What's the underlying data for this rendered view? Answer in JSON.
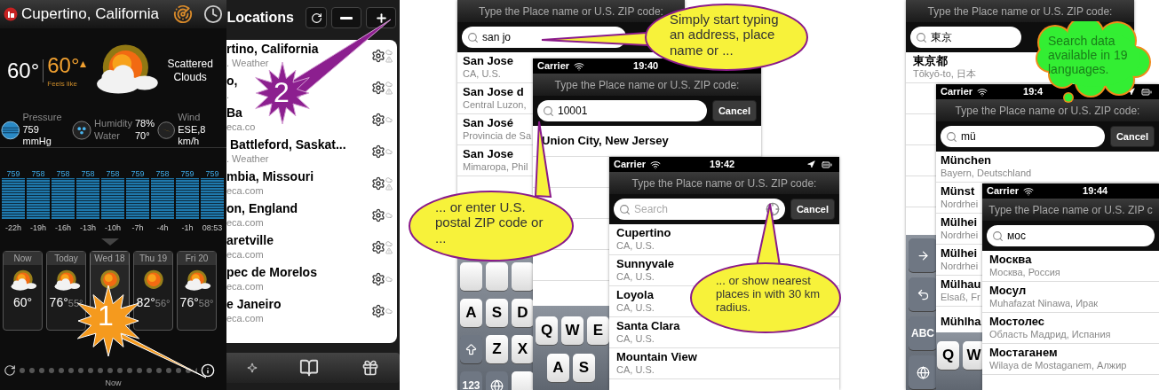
{
  "weather": {
    "location": "Cupertino, California",
    "temperature": "60°",
    "feels_like_temp": "60°",
    "feels_like_label": "Feels like",
    "condition": "Scattered Clouds",
    "stats": [
      {
        "kind": "pressure",
        "label": "Pressure",
        "value": "759 mmHg"
      },
      {
        "kind": "humidity",
        "label": "Humidity",
        "value": "78%",
        "label_2": "Water",
        "value_2": "70°"
      },
      {
        "kind": "wind",
        "label": "Wind",
        "value": "ESE,8 km/h"
      }
    ],
    "pressure_chart": {
      "chart_data": {
        "type": "bar",
        "categories": [
          "-22h",
          "-19h",
          "-16h",
          "-13h",
          "-10h",
          "-7h",
          "-4h",
          "-1h",
          "08:53"
        ],
        "values": [
          759,
          758,
          758,
          758,
          758,
          759,
          758,
          759,
          759
        ],
        "data_labels": true
      }
    },
    "forecast": [
      {
        "day": "Now",
        "high": "60°",
        "kind": "partly-cloudy",
        "selected": false
      },
      {
        "day": "Today",
        "high": "76°",
        "low": "55°",
        "kind": "partly-cloudy",
        "selected": false
      },
      {
        "day": "Wed 18",
        "kind": "sunny",
        "selected": true
      },
      {
        "day": "Thu 19",
        "high": "82°",
        "low": "56°",
        "kind": "sunny",
        "selected": false
      },
      {
        "day": "Fri 20",
        "high": "76°",
        "low": "58°",
        "kind": "partly-cloudy",
        "selected": false
      }
    ],
    "footer_label": "Now"
  },
  "locations": {
    "title": "Locations",
    "items": [
      {
        "name": "rtino, California",
        "source": ". Weather",
        "alert": true
      },
      {
        "name": "o,",
        "source": ".",
        "alert": true
      },
      {
        "name": "Ba",
        "source": "eca.co",
        "alert": false
      },
      {
        "name": " Battleford, Saskat...",
        "source": ". Weather",
        "alert": false
      },
      {
        "name": "mbia, Missouri",
        "source": "eca.com",
        "alert": true
      },
      {
        "name": "on, England",
        "source": "eca.com",
        "alert": false
      },
      {
        "name": "aretville",
        "source": "eca.com",
        "alert": true
      },
      {
        "name": "pec de Morelos",
        "source": "eca.com",
        "alert": false
      },
      {
        "name": "e Janeiro",
        "source": "eca.com",
        "alert": false
      }
    ]
  },
  "search_screens": [
    {
      "prompt": "Type the Place name or U.S. ZIP code:",
      "query": "san jo",
      "results": [
        {
          "name": "San Jose",
          "region": "CA, U.S."
        },
        {
          "name": "San Jose d",
          "region": "Central Luzon,"
        },
        {
          "name": "San José",
          "region": "Provincia de Sa"
        },
        {
          "name": "San Jose",
          "region": "Mimaropa, Phil"
        }
      ],
      "keyboard": [
        [
          {
            "kind": "blank"
          },
          {
            "kind": "blank"
          },
          {
            "kind": "blank"
          }
        ],
        [
          {
            "kind": "letter",
            "label": "A"
          },
          {
            "kind": "letter",
            "label": "S"
          },
          {
            "kind": "letter",
            "label": "D"
          }
        ],
        [
          {
            "kind": "shift"
          },
          {
            "kind": "letter",
            "label": "Z"
          },
          {
            "kind": "letter",
            "label": "X"
          }
        ],
        [
          {
            "kind": "function",
            "label": "123"
          },
          {
            "kind": "globe"
          },
          {
            "kind": "blank"
          }
        ]
      ]
    },
    {
      "status": {
        "carrier": "Carrier",
        "time": "19:40"
      },
      "prompt": "Type the Place name or U.S. ZIP code:",
      "query": "10001",
      "cancel": "Cancel",
      "results": [
        {
          "name": "Union City, New Jersey"
        }
      ],
      "keyboard": [
        [
          {
            "kind": "letter",
            "label": "Q"
          },
          {
            "kind": "letter",
            "label": "W"
          },
          {
            "kind": "letter",
            "label": "E"
          }
        ],
        [
          {
            "kind": "letter",
            "label": "A"
          },
          {
            "kind": "letter",
            "label": "S"
          }
        ]
      ]
    },
    {
      "status": {
        "carrier": "Carrier",
        "time": "19:42"
      },
      "prompt": "Type the Place name or U.S. ZIP code:",
      "placeholder": "Search",
      "cancel": "Cancel",
      "results": [
        {
          "name": "Cupertino",
          "region": "CA, U.S."
        },
        {
          "name": "Sunnyvale",
          "region": "CA, U.S."
        },
        {
          "name": "Loyola",
          "region": "CA, U.S."
        },
        {
          "name": "Santa Clara",
          "region": "CA, U.S."
        },
        {
          "name": "Mountain View",
          "region": "CA, U.S."
        }
      ]
    },
    {
      "prompt": "Type the Place name or U.S. ZIP code:",
      "query": "東京",
      "results": [
        {
          "name": "東京都",
          "region": "Tōkyō-to, 日本"
        }
      ],
      "keyboard": [
        [
          {
            "kind": "next"
          }
        ],
        [
          {
            "kind": "undo"
          }
        ],
        [
          {
            "kind": "function",
            "label": "ABC"
          }
        ],
        [
          {
            "kind": "globe"
          }
        ]
      ]
    },
    {
      "status": {
        "carrier": "Carrier",
        "time": "19:4"
      },
      "prompt": "Type the Place name or U.S. ZIP code:",
      "query": "mü",
      "cancel": "Cancel",
      "results": [
        {
          "name": "München",
          "region": "Bayern, Deutschland"
        },
        {
          "name": "Münst",
          "region": "Nordrhei"
        },
        {
          "name": "Mülhei",
          "region": "Nordrhei"
        },
        {
          "name": "Mülhei",
          "region": "Nordrhei"
        },
        {
          "name": "Mülhau",
          "region": "Elsaß, Fr"
        },
        {
          "name": "Mühlha"
        }
      ],
      "keyboard": [
        [
          {
            "kind": "letter",
            "label": "Q"
          },
          {
            "kind": "letter",
            "label": "W"
          }
        ]
      ]
    },
    {
      "status": {
        "carrier": "Carrier",
        "time": "19:44"
      },
      "prompt": "Type the Place name or U.S. ZIP c",
      "query": "мос",
      "results": [
        {
          "name": "Москва",
          "region": "Москва, Россия"
        },
        {
          "name": "Мосул",
          "region": "Muhafazat Ninawa, Ирак"
        },
        {
          "name": "Мостолес",
          "region": "Область Мадрид, Испания"
        },
        {
          "name": "Мостаганем",
          "region": "Wilaya de Mostaganem, Алжир"
        }
      ]
    }
  ],
  "callouts": [
    {
      "kind": "ellipse",
      "text": "Simply start typing an address, place name or ..."
    },
    {
      "kind": "ellipse",
      "text": "... or enter U.S. postal ZIP code or ..."
    },
    {
      "kind": "ellipse",
      "text": "... or show nearest places in with 30 km radius."
    },
    {
      "kind": "cloud",
      "text": "Search data available in 19 languages."
    }
  ],
  "markers": [
    {
      "label": "1"
    },
    {
      "label": "2"
    }
  ]
}
